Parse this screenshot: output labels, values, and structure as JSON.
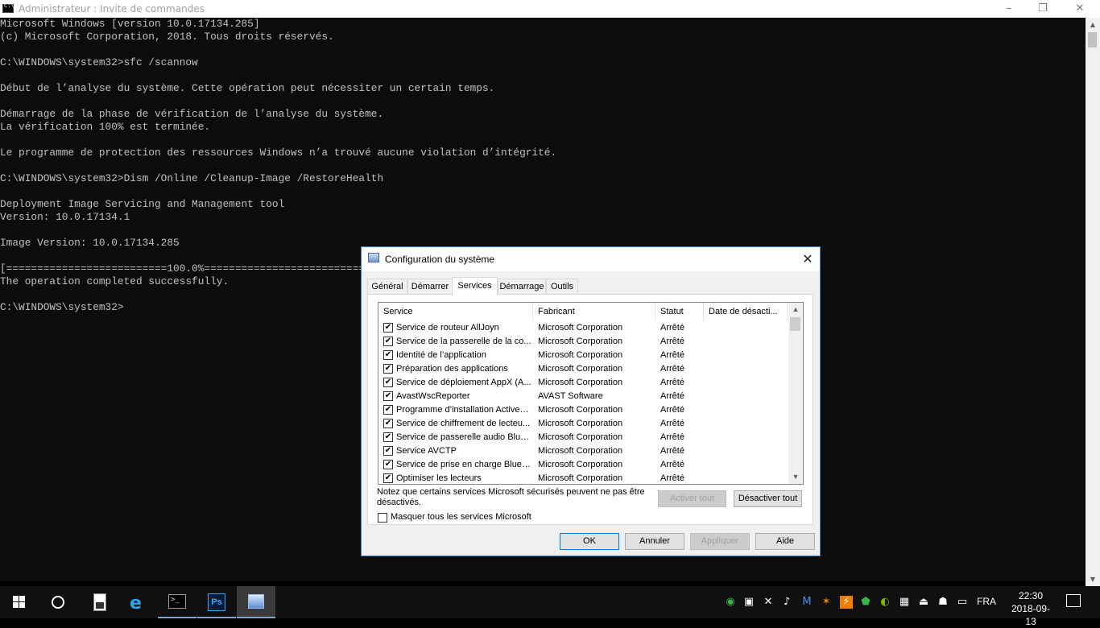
{
  "console_window": {
    "title": "Administrateur : Invite de commandes",
    "minimize": "–",
    "restore": "❐",
    "close": "✕",
    "lines": [
      "Microsoft Windows [version 10.0.17134.285]",
      "(c) Microsoft Corporation, 2018. Tous droits réservés.",
      "",
      "C:\\WINDOWS\\system32>sfc /scannow",
      "",
      "Début de l’analyse du système. Cette opération peut nécessiter un certain temps.",
      "",
      "Démarrage de la phase de vérification de l’analyse du système.",
      "La vérification 100% est terminée.",
      "",
      "Le programme de protection des ressources Windows n’a trouvé aucune violation d’intégrité.",
      "",
      "C:\\WINDOWS\\system32>Dism /Online /Cleanup-Image /RestoreHealth",
      "",
      "Deployment Image Servicing and Management tool",
      "Version: 10.0.17134.1",
      "",
      "Image Version: 10.0.17134.285",
      "",
      "[==========================100.0%==========================]",
      "The operation completed successfully.",
      "",
      "C:\\WINDOWS\\system32>"
    ]
  },
  "dialog": {
    "title": "Configuration du système",
    "close": "✕",
    "tabs": [
      "Général",
      "Démarrer",
      "Services",
      "Démarrage",
      "Outils"
    ],
    "active_tab": "Services",
    "columns": [
      "Service",
      "Fabricant",
      "Statut",
      "Date de désacti..."
    ],
    "sort_arrow": "^",
    "services": [
      {
        "name": "Service de routeur AllJoyn",
        "vendor": "Microsoft Corporation",
        "status": "Arrêté",
        "date": "",
        "checked": "✔"
      },
      {
        "name": "Service de la passerelle de la co...",
        "vendor": "Microsoft Corporation",
        "status": "Arrêté",
        "date": "",
        "checked": "✔"
      },
      {
        "name": "Identité de l’application",
        "vendor": "Microsoft Corporation",
        "status": "Arrêté",
        "date": "",
        "checked": "✔"
      },
      {
        "name": "Préparation des applications",
        "vendor": "Microsoft Corporation",
        "status": "Arrêté",
        "date": "",
        "checked": "✔"
      },
      {
        "name": "Service de déploiement AppX (A...",
        "vendor": "Microsoft Corporation",
        "status": "Arrêté",
        "date": "",
        "checked": "✔"
      },
      {
        "name": "AvastWscReporter",
        "vendor": "AVAST Software",
        "status": "Arrêté",
        "date": "",
        "checked": "✔"
      },
      {
        "name": "Programme d’installation ActiveX...",
        "vendor": "Microsoft Corporation",
        "status": "Arrêté",
        "date": "",
        "checked": "✔"
      },
      {
        "name": "Service de chiffrement de lecteu...",
        "vendor": "Microsoft Corporation",
        "status": "Arrêté",
        "date": "",
        "checked": "✔"
      },
      {
        "name": "Service de passerelle audio Blue...",
        "vendor": "Microsoft Corporation",
        "status": "Arrêté",
        "date": "",
        "checked": "✔"
      },
      {
        "name": "Service AVCTP",
        "vendor": "Microsoft Corporation",
        "status": "Arrêté",
        "date": "",
        "checked": "✔"
      },
      {
        "name": "Service de prise en charge Bluet...",
        "vendor": "Microsoft Corporation",
        "status": "Arrêté",
        "date": "",
        "checked": "✔"
      },
      {
        "name": "Optimiser les lecteurs",
        "vendor": "Microsoft Corporation",
        "status": "Arrêté",
        "date": "",
        "checked": "✔"
      }
    ],
    "note": "Notez que certains services Microsoft sécurisés peuvent ne pas être désactivés.",
    "enable_all": "Activer tout",
    "disable_all": "Désactiver tout",
    "hide_microsoft": "Masquer tous les services Microsoft",
    "ok": "OK",
    "cancel": "Annuler",
    "apply": "Appliquer",
    "help": "Aide"
  },
  "taskbar": {
    "language": "FRA",
    "time": "22:30",
    "date": "2018-09-13",
    "tray_icons": [
      "utorrent-icon",
      "network-icon",
      "speaker-muted-icon",
      "volume-icon",
      "malwarebytes-icon",
      "avast-icon",
      "orange-app-icon",
      "green-shield-icon",
      "nvidia-icon",
      "grid-app-icon",
      "usb-icon",
      "people-icon",
      "display-icon"
    ]
  },
  "colors": {
    "console_bg": "#0c0c0c",
    "console_text": "#c0c0c0",
    "taskbar_bg": "#101010",
    "accent": "#0078d7"
  }
}
